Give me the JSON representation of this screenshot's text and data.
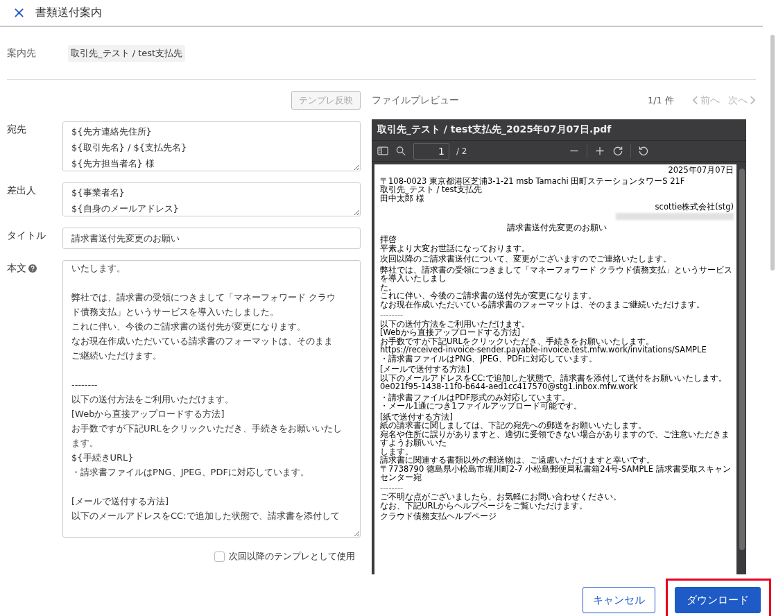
{
  "header": {
    "title": "書類送付案内"
  },
  "recipient": {
    "label": "案内先",
    "value": "取引先_テスト / test支払先"
  },
  "template_button": {
    "label": "テンプレ反映",
    "disabled": true
  },
  "fields": [
    {
      "kind": "textarea",
      "label": "宛先",
      "lines": [
        "${先方連絡先住所}",
        "${取引先名} / ${支払先名}",
        "${先方担当者名} 様"
      ]
    },
    {
      "kind": "textarea",
      "label": "差出人",
      "lines": [
        "${事業者名}",
        "${自身のメールアドレス}"
      ]
    },
    {
      "kind": "input",
      "label": "タイトル",
      "value": "請求書送付先変更のお願い"
    },
    {
      "kind": "textarea",
      "label": "本文",
      "help": true,
      "paragraphs": [
        [
          "いたします。"
        ],
        [
          "弊社では、請求書の受領につきまして「マネーフォワード クラウ",
          "ド債務支払」というサービスを導入いたしました。",
          "これに伴い、今後のご請求書の送付先が変更になります。",
          "なお現在作成いただいている請求書のフォーマットは、そのまま",
          "ご継続いただけます。"
        ],
        [
          "--------",
          "以下の送付方法をご利用いただけます。",
          "[Webから直接アップロードする方法]",
          "お手数ですが下記URLをクリックいただき、手続きをお願いいたし",
          "ます。",
          "${手続きURL}",
          "・請求書ファイルはPNG、JPEG、PDFに対応しています。"
        ],
        [
          "[メールで送付する方法]",
          "以下のメールアドレスをCC:で追加した状態で、請求書を添付して"
        ]
      ]
    }
  ],
  "save_template": {
    "label": "次回以降のテンプレとして使用",
    "checked": false
  },
  "preview": {
    "heading": "ファイルプレビュー",
    "count": "1/1 件",
    "prev": {
      "label": "前へ",
      "disabled": true
    },
    "next": {
      "label": "次へ",
      "disabled": true
    },
    "file_name": "取引先_テスト / test支払先_2025年07月07日.pdf",
    "page": "1",
    "page_total": "/ 2",
    "lines": [
      {
        "kind": "right",
        "text": "2025年07月07日"
      },
      {
        "kind": "gap"
      },
      {
        "kind": "left",
        "text": "〒108-0023 東京都港区芝浦3-1-21 msb Tamachi 田町ステーションタワーS 21F"
      },
      {
        "kind": "left",
        "text": "取引先_テスト / test支払先"
      },
      {
        "kind": "left",
        "text": "田中太郎 様"
      },
      {
        "kind": "right",
        "text": "scottie株式会社(stg)"
      },
      {
        "kind": "redacted"
      },
      {
        "kind": "gap"
      },
      {
        "kind": "center",
        "text": "請求書送付先変更のお願い"
      },
      {
        "kind": "gap"
      },
      {
        "kind": "left",
        "text": "拝啓"
      },
      {
        "kind": "left",
        "text": "平素より大変お世話になっております。"
      },
      {
        "kind": "gap"
      },
      {
        "kind": "left",
        "text": "次回以降のご請求書送付について、変更がございますのでご連絡いたします。"
      },
      {
        "kind": "gap"
      },
      {
        "kind": "left",
        "text": "弊社では、請求書の受領につきまして「マネーフォワード クラウド債務支払」というサービスを導入いたしまし"
      },
      {
        "kind": "left",
        "text": "た。"
      },
      {
        "kind": "left",
        "text": "これに伴い、今後のご請求書の送付先が変更になります。"
      },
      {
        "kind": "left",
        "text": "なお現在作成いただいている請求書のフォーマットは、そのままご継続いただけます。"
      },
      {
        "kind": "gap"
      },
      {
        "kind": "faint",
        "text": "--------"
      },
      {
        "kind": "left",
        "text": "以下の送付方法をご利用いただけます。"
      },
      {
        "kind": "left",
        "text": "[Webから直接アップロードする方法]"
      },
      {
        "kind": "left",
        "text": "お手数ですが下記URLをクリックいただき、手続きをお願いいたします。"
      },
      {
        "kind": "left",
        "text": "https://received-invoice-sender.payable-invoice.test.mfw.work/invitations/SAMPLE"
      },
      {
        "kind": "left",
        "text": "・請求書ファイルはPNG、JPEG、PDFに対応しています。"
      },
      {
        "kind": "gap"
      },
      {
        "kind": "left",
        "text": "[メールで送付する方法]"
      },
      {
        "kind": "left",
        "text": "以下のメールアドレスをCC:で追加した状態で、請求書を添付して送付をお願いいたします。"
      },
      {
        "kind": "left",
        "text": "0e021f95-1438-11f0-b644-aed1cc417570@stg1.inbox.mfw.work"
      },
      {
        "kind": "gap"
      },
      {
        "kind": "left",
        "text": "・請求書ファイルはPDF形式のみ対応しています。"
      },
      {
        "kind": "left",
        "text": "・メール1通につき1ファイルアップロード可能です。"
      },
      {
        "kind": "gap"
      },
      {
        "kind": "left",
        "text": "[紙で送付する方法]"
      },
      {
        "kind": "left",
        "text": "紙の請求書に関しましては、下記の宛先への郵送をお願いいたします。"
      },
      {
        "kind": "left",
        "text": "宛名や住所に誤りがありますと、適切に受領できない場合がありますので、ご注意いただきますようお願いいた"
      },
      {
        "kind": "left",
        "text": "します。"
      },
      {
        "kind": "left",
        "text": "請求書に関連する書類以外の郵送物は、ご遠慮いただけますと幸いです。"
      },
      {
        "kind": "left",
        "text": "〒7738790 徳島県小松島市堀川町2-7 小松島郵便局私書箱24号-SAMPLE 請求書受取スキャンセンター宛"
      },
      {
        "kind": "gap"
      },
      {
        "kind": "faint",
        "text": "--------"
      },
      {
        "kind": "left",
        "text": "ご不明な点がございましたら、お気軽にお問い合わせください。"
      },
      {
        "kind": "left",
        "text": "なお、下記URLからヘルプページをご覧いただけます。"
      },
      {
        "kind": "gap"
      },
      {
        "kind": "left",
        "text": "クラウド債務支払ヘルプページ"
      }
    ]
  },
  "buttons": [
    {
      "kind": "secondary",
      "label": "キャンセル",
      "highlighted": false
    },
    {
      "kind": "primary",
      "label": "ダウンロード",
      "highlighted": true
    }
  ]
}
